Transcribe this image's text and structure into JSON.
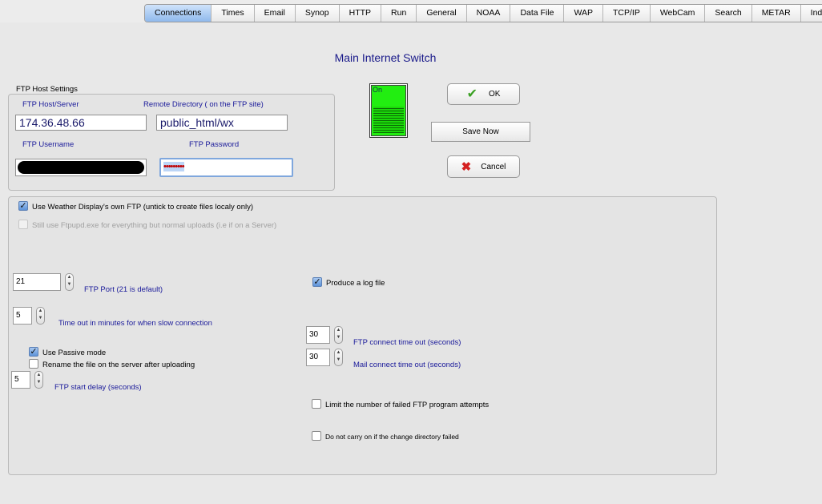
{
  "tabs": [
    {
      "label": "Connections",
      "active": true
    },
    {
      "label": "Times"
    },
    {
      "label": "Email"
    },
    {
      "label": "Synop"
    },
    {
      "label": "HTTP"
    },
    {
      "label": "Run"
    },
    {
      "label": "General"
    },
    {
      "label": "NOAA"
    },
    {
      "label": "Data File"
    },
    {
      "label": "WAP"
    },
    {
      "label": "TCP/IP"
    },
    {
      "label": "WebCam"
    },
    {
      "label": "Search"
    },
    {
      "label": "METAR"
    },
    {
      "label": "Indigo"
    }
  ],
  "title": "Main Internet Switch",
  "switch": {
    "label": "On",
    "color": "#22ee11"
  },
  "buttons": {
    "ok": "OK",
    "save_now": "Save Now",
    "cancel": "Cancel"
  },
  "ftp_host": {
    "group_label": "FTP Host Settings",
    "server_label": "FTP Host/Server",
    "server_value": "174.36.48.66",
    "remote_dir_label": "Remote Directory ( on the FTP site)",
    "remote_dir_value": "public_html/wx",
    "username_label": "FTP Username",
    "password_label": "FTP Password",
    "password_value": "•••••••••"
  },
  "options": {
    "own_ftp": {
      "label": "Use Weather Display's own FTP  (untick to create files localy only)",
      "checked": true
    },
    "ftpupd": {
      "label": "Still use Ftpupd.exe for everything but normal uploads (i.e if on a Server)",
      "checked": false,
      "disabled": true
    },
    "port": {
      "value": "21",
      "label": "FTP Port (21 is default)"
    },
    "timeout": {
      "value": "5",
      "label": "Time out in minutes for when slow connection"
    },
    "passive": {
      "label": "Use Passive mode",
      "checked": true
    },
    "rename": {
      "label": "Rename the file on the server after uploading",
      "checked": false
    },
    "start_delay": {
      "value": "5",
      "label": "FTP start delay (seconds)"
    },
    "log_file": {
      "label": "Produce a log file",
      "checked": true
    },
    "connect_timeout": {
      "value": "30",
      "label": "FTP connect time out (seconds)"
    },
    "mail_timeout": {
      "value": "30",
      "label": "Mail connect time out (seconds)"
    },
    "limit_failed": {
      "label": "Limit the number of failed FTP program attempts",
      "checked": false
    },
    "no_carry": {
      "label": "Do not carry on if the change directory failed",
      "checked": false
    }
  }
}
